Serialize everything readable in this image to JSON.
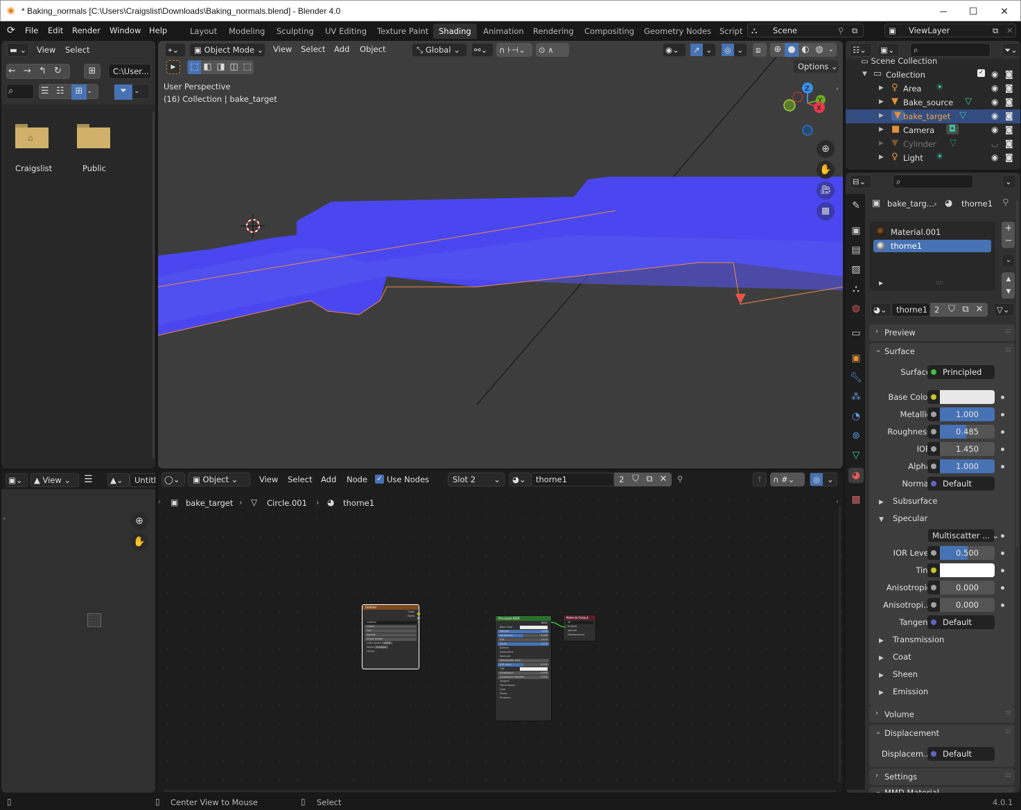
{
  "window": {
    "title": "* Baking_normals [C:\\Users\\Craigslist\\Downloads\\Baking_normals.blend] - Blender 4.0",
    "minimize": "─",
    "maximize": "☐",
    "close": "✕"
  },
  "menubar": {
    "items": [
      "File",
      "Edit",
      "Render",
      "Window",
      "Help"
    ]
  },
  "workspaces": [
    "Layout",
    "Modeling",
    "Sculpting",
    "UV Editing",
    "Texture Paint",
    "Shading",
    "Animation",
    "Rendering",
    "Compositing",
    "Geometry Nodes",
    "Script"
  ],
  "active_workspace": "Shading",
  "scene": {
    "name": "Scene",
    "view_layer": "ViewLayer"
  },
  "file_browser": {
    "menu": [
      "View",
      "Select"
    ],
    "path": "C:\\User...",
    "items": [
      {
        "name": "Craigslist",
        "icon": "home-folder-icon"
      },
      {
        "name": "Public",
        "icon": "folder-icon"
      }
    ]
  },
  "viewport": {
    "mode": "Object Mode",
    "menu": [
      "View",
      "Select",
      "Add",
      "Object"
    ],
    "orientation": "Global",
    "options_label": "Options",
    "overlay_line1": "User Perspective",
    "overlay_line2": "(16) Collection | bake_target",
    "gizmo_axes": [
      "Z",
      "Y",
      "X"
    ],
    "colors": {
      "mesh": "#4a47f0",
      "background": "#3d3d3d",
      "outline": "#f08a4b"
    }
  },
  "outliner": {
    "root": "Scene Collection",
    "collection": "Collection",
    "objects": [
      {
        "name": "Area",
        "type": "light",
        "selected": false,
        "hidden": false
      },
      {
        "name": "Bake_source",
        "type": "mesh",
        "selected": false,
        "hidden": false
      },
      {
        "name": "bake_target",
        "type": "mesh",
        "selected": true,
        "hidden": false
      },
      {
        "name": "Camera",
        "type": "camera",
        "selected": false,
        "hidden": false
      },
      {
        "name": "Cylinder",
        "type": "mesh",
        "selected": false,
        "hidden": true
      },
      {
        "name": "Light",
        "type": "light",
        "selected": false,
        "hidden": false
      }
    ]
  },
  "properties": {
    "breadcrumb_object": "bake_targ...",
    "breadcrumb_material": "thorne1",
    "material_slots": [
      "Material.001",
      "thorne1"
    ],
    "active_slot": "thorne1",
    "material_name": "thorne1",
    "material_users": "2",
    "panels": {
      "preview": "Preview",
      "surface": "Surface",
      "volume": "Volume",
      "displacement": "Displacement",
      "settings": "Settings",
      "mmd": "MMD Material"
    },
    "surface_shader": "Principled BS...",
    "fields": [
      {
        "label": "Surface",
        "kind": "link",
        "value": "Principled BS...",
        "socket": "#3fbf3f"
      },
      {
        "label": "Base Color",
        "kind": "color",
        "value": "#e8e8e8",
        "socket": "#c7c729"
      },
      {
        "label": "Metallic",
        "kind": "slider",
        "value": "1.000",
        "fraction": 1.0,
        "socket": "#a1a1a1"
      },
      {
        "label": "Roughness",
        "kind": "slider",
        "value": "0.485",
        "fraction": 0.485,
        "socket": "#a1a1a1"
      },
      {
        "label": "IOR",
        "kind": "slider",
        "value": "1.450",
        "fraction": 0,
        "socket": "#a1a1a1"
      },
      {
        "label": "Alpha",
        "kind": "slider",
        "value": "1.000",
        "fraction": 1.0,
        "socket": "#a1a1a1"
      },
      {
        "label": "Normal",
        "kind": "link",
        "value": "Default",
        "socket": "#6363c7"
      }
    ],
    "subpanels_a": [
      "Subsurface",
      "Specular"
    ],
    "specular": {
      "distribution": "Multiscatter ...",
      "fields": [
        {
          "label": "IOR Level",
          "kind": "slider",
          "value": "0.500",
          "fraction": 0.5,
          "socket": "#a1a1a1"
        },
        {
          "label": "Tint",
          "kind": "color",
          "value": "#ffffff",
          "socket": "#c7c729"
        },
        {
          "label": "Anisotropic",
          "kind": "slider",
          "value": "0.000",
          "fraction": 0,
          "socket": "#a1a1a1"
        },
        {
          "label": "Anisotropi...",
          "kind": "slider",
          "value": "0.000",
          "fraction": 0,
          "socket": "#a1a1a1"
        },
        {
          "label": "Tangent",
          "kind": "link",
          "value": "Default",
          "socket": "#6363c7"
        }
      ]
    },
    "subpanels_b": [
      "Transmission",
      "Coat",
      "Sheen",
      "Emission"
    ],
    "displacement_label": "Displacem...",
    "displacement_value": "Default"
  },
  "image_editor": {
    "view_label": "View",
    "image_name": "Untitle"
  },
  "node_editor": {
    "object_mode": "Object",
    "menu": [
      "View",
      "Select",
      "Add",
      "Node"
    ],
    "use_nodes_label": "Use Nodes",
    "use_nodes": true,
    "slot": "Slot 2",
    "material": "thorne1",
    "users": "2",
    "breadcrumb": [
      "bake_target",
      "Circle.001",
      "thorne1"
    ],
    "nodes": {
      "image": {
        "title": "Untitled",
        "outputs": [
          "Color",
          "Alpha"
        ],
        "image": "Untitled",
        "rows": [
          "Linear",
          "Flat",
          "Repeat",
          "Single Image"
        ],
        "color_space_label": "Color Space",
        "color_space": "sRGB",
        "alpha_label": "Alpha",
        "alpha": "Straight",
        "input": "Vector"
      },
      "bsdf": {
        "title": "Principled BSDF",
        "output": "BSDF",
        "rows": [
          {
            "label": "Base Color",
            "kind": "color"
          },
          {
            "label": "Metallic",
            "value": "1.000",
            "kind": "blue"
          },
          {
            "label": "Roughness",
            "value": "0.485",
            "kind": "half"
          },
          {
            "label": "IOR",
            "value": "1.450",
            "kind": "grey"
          },
          {
            "label": "Alpha",
            "value": "1.000",
            "kind": "blue"
          }
        ],
        "normal": "Normal",
        "subsurface": "Subsurface",
        "specular": "Specular",
        "distribution": "Multiscatter GGX",
        "spec_rows": [
          {
            "label": "IOR Level",
            "value": "0.500",
            "kind": "half"
          },
          {
            "label": "Tint",
            "kind": "color"
          },
          {
            "label": "Anisotropic",
            "value": "0.000",
            "kind": "grey"
          },
          {
            "label": "Anisotropic Rotation",
            "value": "0.000",
            "kind": "grey"
          }
        ],
        "tangent": "Tangent",
        "collapsed": [
          "Transmission",
          "Coat",
          "Sheen",
          "Emission"
        ]
      },
      "output": {
        "title": "Material Output",
        "target": "All",
        "inputs": [
          "Surface",
          "Volume",
          "Displacement"
        ]
      }
    }
  },
  "statusbar": {
    "hint1": "Center View to Mouse",
    "hint2": "Select",
    "version": "4.0.1"
  }
}
